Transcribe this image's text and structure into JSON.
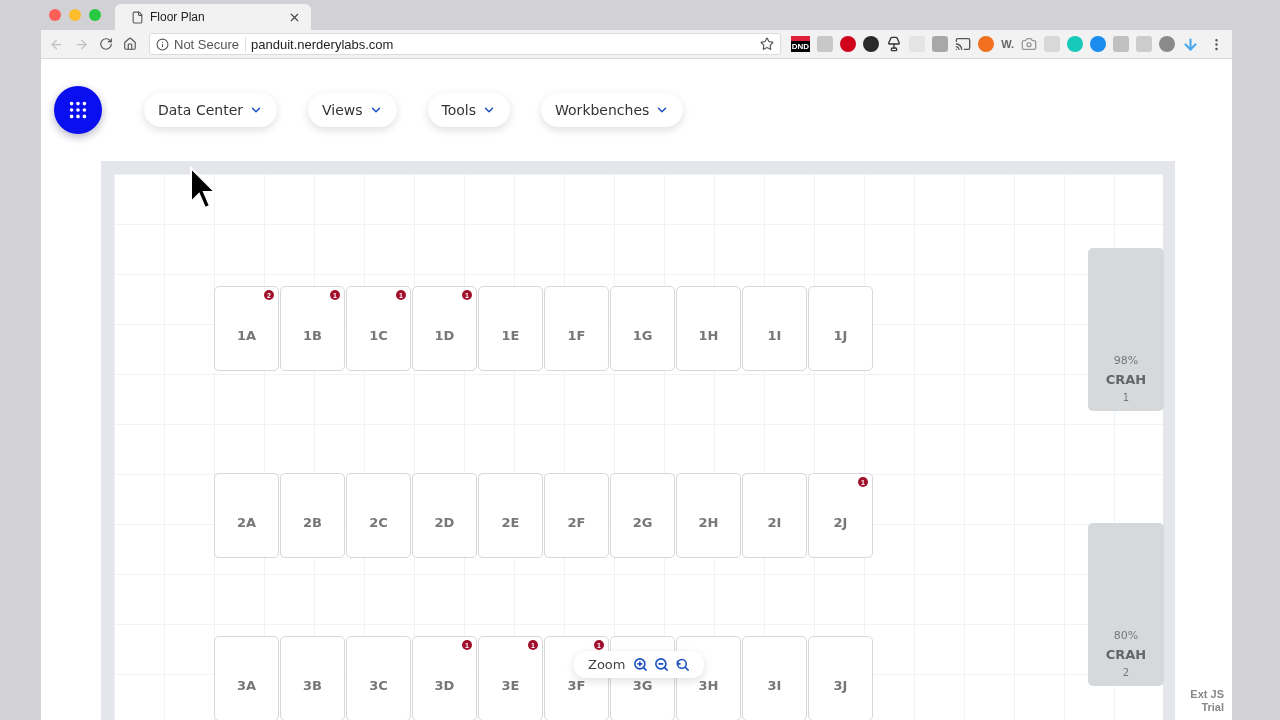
{
  "browser": {
    "tab": {
      "title": "Floor Plan"
    },
    "address": {
      "security": "Not Secure",
      "url": "panduit.nerderylabs.com"
    },
    "extensions": [
      {
        "kind": "label",
        "text": "DND",
        "color": "#e0203a"
      },
      {
        "kind": "square",
        "color": "#c8c8c8"
      },
      {
        "kind": "round",
        "color": "#d0021b"
      },
      {
        "kind": "round",
        "color": "#2a2a2a"
      },
      {
        "kind": "lamp",
        "color": "#333333"
      },
      {
        "kind": "square",
        "color": "#e4e4e4"
      },
      {
        "kind": "square",
        "color": "#a8a8a8"
      },
      {
        "kind": "cast",
        "color": "#555555"
      },
      {
        "kind": "round",
        "color": "#f07020"
      },
      {
        "kind": "label",
        "text": "W.",
        "color": "#666666"
      },
      {
        "kind": "camera",
        "color": "#999999"
      },
      {
        "kind": "square",
        "color": "#d8d8d8"
      },
      {
        "kind": "round",
        "color": "#18c8b8"
      },
      {
        "kind": "round",
        "color": "#1a8cf0"
      },
      {
        "kind": "square",
        "color": "#c0c0c0"
      },
      {
        "kind": "square",
        "color": "#cccccc"
      },
      {
        "kind": "round",
        "color": "#8a8a8a"
      },
      {
        "kind": "arrow",
        "color": "#4aa8f0"
      }
    ]
  },
  "nav": {
    "menus": [
      {
        "label": "Data Center"
      },
      {
        "label": "Views"
      },
      {
        "label": "Tools"
      },
      {
        "label": "Workbenches"
      }
    ]
  },
  "floor": {
    "rows": [
      {
        "racks": [
          {
            "label": "1A",
            "alerts": "2"
          },
          {
            "label": "1B",
            "alerts": "1"
          },
          {
            "label": "1C",
            "alerts": "1"
          },
          {
            "label": "1D",
            "alerts": "1"
          },
          {
            "label": "1E"
          },
          {
            "label": "1F"
          },
          {
            "label": "1G"
          },
          {
            "label": "1H"
          },
          {
            "label": "1I"
          },
          {
            "label": "1J"
          }
        ]
      },
      {
        "racks": [
          {
            "label": "2A"
          },
          {
            "label": "2B"
          },
          {
            "label": "2C"
          },
          {
            "label": "2D"
          },
          {
            "label": "2E"
          },
          {
            "label": "2F"
          },
          {
            "label": "2G"
          },
          {
            "label": "2H"
          },
          {
            "label": "2I"
          },
          {
            "label": "2J",
            "alerts": "1"
          }
        ]
      },
      {
        "racks": [
          {
            "label": "3A"
          },
          {
            "label": "3B"
          },
          {
            "label": "3C"
          },
          {
            "label": "3D",
            "alerts": "1"
          },
          {
            "label": "3E",
            "alerts": "1"
          },
          {
            "label": "3F",
            "alerts": "1"
          },
          {
            "label": "3G"
          },
          {
            "label": "3H"
          },
          {
            "label": "3I"
          },
          {
            "label": "3J"
          }
        ]
      }
    ],
    "crah": [
      {
        "reading": "98%",
        "name": "CRAH",
        "number": "1"
      },
      {
        "reading": "80%",
        "name": "CRAH",
        "number": "2"
      }
    ],
    "zoom": {
      "label": "Zoom"
    }
  },
  "trial_notice": [
    "Ext JS",
    "Trial"
  ]
}
